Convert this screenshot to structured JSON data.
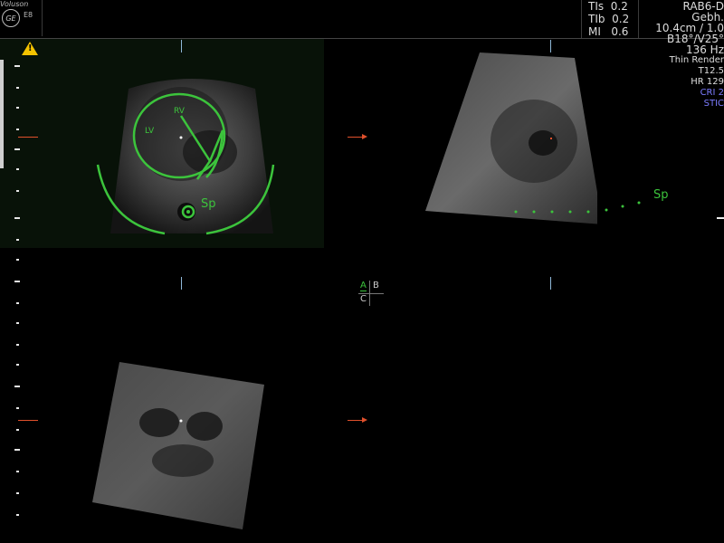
{
  "header": {
    "brand": "Voluson",
    "logo": "GE",
    "probe_short": "E8",
    "indices": [
      {
        "label": "TIs",
        "value": "0.2"
      },
      {
        "label": "TIb",
        "value": "0.2"
      },
      {
        "label": "MI",
        "value": "0.6"
      }
    ],
    "probe_name": "RAB6-D",
    "preset": "Gebh.",
    "depth": "10.4cm / 1.0",
    "angles": "B18°/V25°",
    "rate": "136 Hz",
    "render_mode": "Thin Render",
    "thickness": "T12.5",
    "heart_rate": "HR 129",
    "cri": "CRI 2",
    "mode": "STIC"
  },
  "panel_a": {
    "labels": {
      "rv": "RV",
      "lv": "LV",
      "spine": "Sp"
    },
    "warning_icon": "warning-icon"
  },
  "panel_b": {
    "labels": {
      "spine": "Sp"
    }
  },
  "quadrant": {
    "a": "A",
    "b": "B",
    "c": "C"
  },
  "colors": {
    "trace": "#3cc43c",
    "arrow": "#e0502c",
    "warning": "#f4c300",
    "stic": "#7c7cff"
  }
}
